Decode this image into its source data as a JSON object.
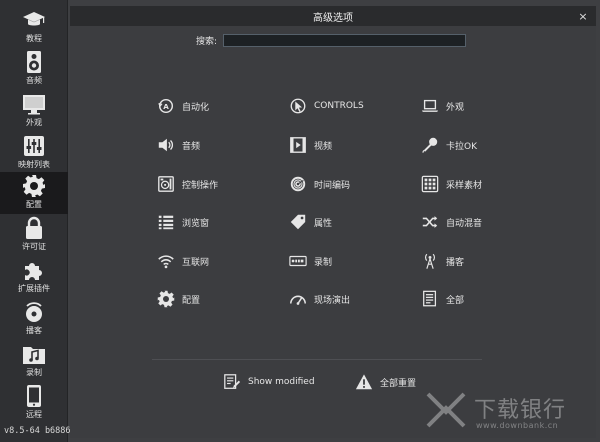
{
  "sidebar": {
    "items": [
      {
        "label": "教程",
        "icon": "graduation-cap-icon"
      },
      {
        "label": "音频",
        "icon": "speaker-icon"
      },
      {
        "label": "外观",
        "icon": "monitor-icon"
      },
      {
        "label": "映射列表",
        "icon": "sliders-icon"
      },
      {
        "label": "配置",
        "icon": "gear-icon"
      },
      {
        "label": "许可证",
        "icon": "lock-icon"
      },
      {
        "label": "扩展插件",
        "icon": "puzzle-icon"
      },
      {
        "label": "播客",
        "icon": "broadcast-icon"
      },
      {
        "label": "录制",
        "icon": "music-folder-icon"
      },
      {
        "label": "远程",
        "icon": "tablet-icon"
      }
    ],
    "active": "配置",
    "version": "v8.5-64 b6886"
  },
  "dialog": {
    "title": "高级选项",
    "close_label": "×"
  },
  "search": {
    "label": "搜索:",
    "value": "",
    "placeholder": ""
  },
  "options": {
    "col1": [
      {
        "label": "自动化",
        "icon": "automation-icon"
      },
      {
        "label": "音频",
        "icon": "volume-icon"
      },
      {
        "label": "控制操作",
        "icon": "controller-icon"
      },
      {
        "label": "浏览窗",
        "icon": "list-icon"
      },
      {
        "label": "互联网",
        "icon": "wifi-icon"
      },
      {
        "label": "配置",
        "icon": "gear-icon"
      }
    ],
    "col2": [
      {
        "label": "CONTROLS",
        "icon": "cursor-icon"
      },
      {
        "label": "视频",
        "icon": "film-icon"
      },
      {
        "label": "时间编码",
        "icon": "disc-icon"
      },
      {
        "label": "属性",
        "icon": "tag-icon"
      },
      {
        "label": "录制",
        "icon": "rec-icon"
      },
      {
        "label": "现场演出",
        "icon": "gauge-icon"
      }
    ],
    "col3": [
      {
        "label": "外观",
        "icon": "laptop-icon"
      },
      {
        "label": "卡拉OK",
        "icon": "microphone-icon"
      },
      {
        "label": "采样素材",
        "icon": "grid-icon"
      },
      {
        "label": "自动混音",
        "icon": "shuffle-icon"
      },
      {
        "label": "播客",
        "icon": "antenna-icon"
      },
      {
        "label": "全部",
        "icon": "document-icon"
      }
    ]
  },
  "footer": {
    "show_modified": "Show modified",
    "reset_all": "全部重置"
  },
  "watermark": {
    "text": "下载银行",
    "url": "www.downbank.cn"
  }
}
